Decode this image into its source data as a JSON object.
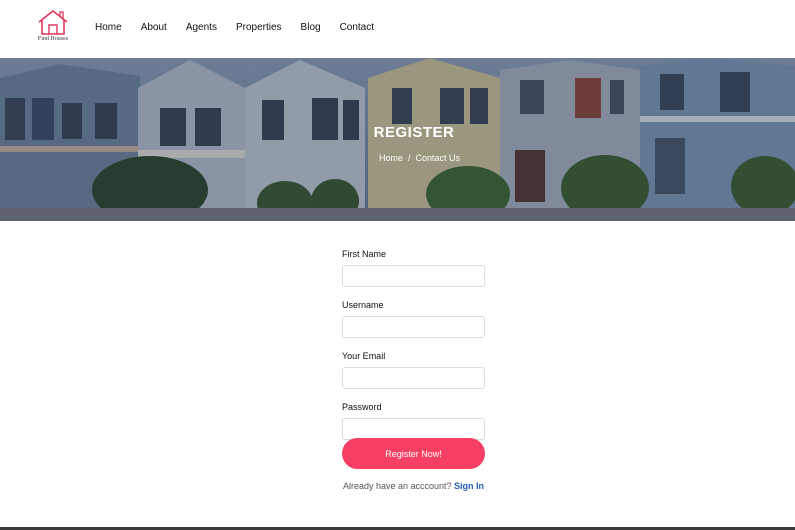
{
  "brand": {
    "name": "Find Houses",
    "accent": "#e0365c"
  },
  "nav": {
    "items": [
      {
        "label": "Home"
      },
      {
        "label": "About"
      },
      {
        "label": "Agents"
      },
      {
        "label": "Properties"
      },
      {
        "label": "Blog"
      },
      {
        "label": "Contact"
      }
    ]
  },
  "hero": {
    "title": "REGISTER",
    "breadcrumb": {
      "home": "Home",
      "separator": "/",
      "current": "Contact Us"
    }
  },
  "form": {
    "fields": [
      {
        "label": "First Name",
        "value": ""
      },
      {
        "label": "Username",
        "value": ""
      },
      {
        "label": "Your Email",
        "value": ""
      },
      {
        "label": "Password",
        "value": ""
      }
    ],
    "submit_label": "Register Now!",
    "button_color": "#f63f63"
  },
  "signin": {
    "prompt": "Already have an acccount?",
    "link_label": "Sign In",
    "link_color": "#1f5fb4"
  }
}
